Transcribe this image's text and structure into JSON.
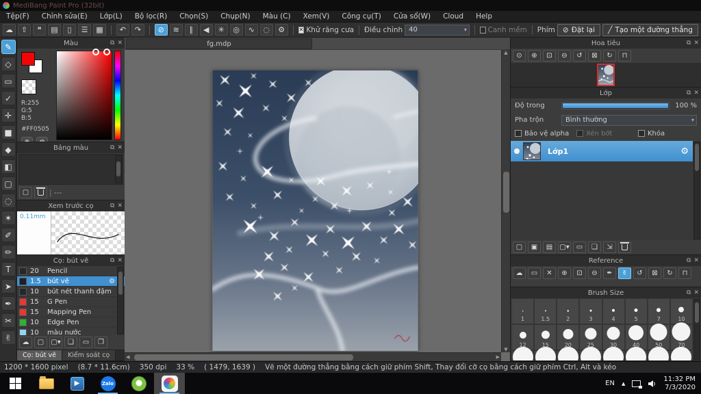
{
  "window": {
    "title": "MediBang Paint Pro (32bit)"
  },
  "menu": {
    "items": [
      {
        "name": "menu-file",
        "label": "Tệp(F)"
      },
      {
        "name": "menu-edit",
        "label": "Chỉnh sửa(E)"
      },
      {
        "name": "menu-layer",
        "label": "Lớp(L)"
      },
      {
        "name": "menu-filter",
        "label": "Bộ lọc(R)"
      },
      {
        "name": "menu-select",
        "label": "Chọn(S)"
      },
      {
        "name": "menu-capture",
        "label": "Chụp(N)"
      },
      {
        "name": "menu-color",
        "label": "Màu (C)"
      },
      {
        "name": "menu-view",
        "label": "Xem(V)"
      },
      {
        "name": "menu-tools",
        "label": "Công cụ(T)"
      },
      {
        "name": "menu-window",
        "label": "Cửa sổ(W)"
      },
      {
        "name": "menu-cloud",
        "label": "Cloud"
      },
      {
        "name": "menu-help",
        "label": "Help"
      }
    ]
  },
  "toolbar": {
    "file_buttons": [
      {
        "name": "cloud-button",
        "glyph": "☁"
      },
      {
        "name": "export-button",
        "glyph": "⇧"
      },
      {
        "name": "comment-button",
        "glyph": "❝"
      },
      {
        "name": "note-button",
        "glyph": "▤"
      },
      {
        "name": "document-button",
        "glyph": "▯"
      },
      {
        "name": "list-button",
        "glyph": "☰"
      },
      {
        "name": "grid-button",
        "glyph": "▦"
      }
    ],
    "history_buttons": [
      {
        "name": "undo-button",
        "glyph": "↶"
      },
      {
        "name": "redo-button",
        "glyph": "↷"
      }
    ],
    "snap_buttons": [
      {
        "name": "snap-off-button",
        "glyph": "⊘",
        "sel": true
      },
      {
        "name": "snap-parallel-button",
        "glyph": "≋"
      },
      {
        "name": "snap-crosshatch-button",
        "glyph": "∥"
      },
      {
        "name": "snap-vanishing-button",
        "glyph": "◀"
      },
      {
        "name": "snap-radial-button",
        "glyph": "✳"
      },
      {
        "name": "snap-concentric-button",
        "glyph": "◎"
      },
      {
        "name": "snap-curve-button",
        "glyph": "∿"
      },
      {
        "name": "snap-ellipse-button",
        "glyph": "◌"
      },
      {
        "name": "snap-settings-button",
        "glyph": "⚙"
      }
    ],
    "antialias_label": "Khử răng cưa",
    "correction_label": "Điều chỉnh",
    "correction_value": "40",
    "soft_edge_label": "Canh mềm",
    "key_label": "Phím",
    "reset_label": "Đặt lại",
    "line_label": "Tạo một đường thẳng"
  },
  "tools": [
    {
      "name": "brush-tool",
      "glyph": "✎",
      "sel": true
    },
    {
      "name": "eraser-tool",
      "glyph": "◇"
    },
    {
      "name": "figure-brush-tool",
      "glyph": "▭"
    },
    {
      "name": "control-point-tool",
      "glyph": "✓"
    },
    {
      "name": "move-tool",
      "glyph": "✛"
    },
    {
      "name": "fill-rect-tool",
      "glyph": "■"
    },
    {
      "name": "bucket-tool",
      "glyph": "◆"
    },
    {
      "name": "gradient-tool",
      "glyph": "◧"
    },
    {
      "name": "select-tool",
      "glyph": "▢"
    },
    {
      "name": "lasso-tool",
      "glyph": "◌"
    },
    {
      "name": "magic-wand-tool",
      "glyph": "✶"
    },
    {
      "name": "select-pen-tool",
      "glyph": "✐"
    },
    {
      "name": "select-eraser-tool",
      "glyph": "✏"
    },
    {
      "name": "text-tool",
      "glyph": "T"
    },
    {
      "name": "operation-tool",
      "glyph": "➤"
    },
    {
      "name": "eyedropper-tool",
      "glyph": "✒"
    },
    {
      "name": "divide-tool",
      "glyph": "✂"
    },
    {
      "name": "hand-tool",
      "glyph": "✌"
    }
  ],
  "color_panel": {
    "title": "Màu",
    "r": "R:255",
    "g": "G:5",
    "b": "B:5",
    "hex": "#FF0505",
    "foreground": "#F20505",
    "buttons": [
      {
        "name": "palette-mode-button",
        "glyph": "◉"
      },
      {
        "name": "color-set-button",
        "glyph": "◍"
      }
    ]
  },
  "palette_panel": {
    "title": "Bảng màu",
    "empty_label": "---",
    "buttons": [
      {
        "name": "palette-add-button",
        "glyph": "▢"
      },
      {
        "name": "palette-delete-button",
        "glyph": "",
        "cls": "has-trash"
      }
    ]
  },
  "preview_panel": {
    "title": "Xem trước cọ",
    "size_label": "0.11mm"
  },
  "brush_panel": {
    "title": "Cọ: bút vẽ",
    "brushes": [
      {
        "size": "20",
        "name": "Pencil",
        "chip": "#26262b",
        "sel": false
      },
      {
        "size": "1.5",
        "name": "bút vẽ",
        "chip": "#1e2126",
        "sel": true
      },
      {
        "size": "10",
        "name": "bút nét thanh đậm",
        "chip": "#23262b",
        "sel": false
      },
      {
        "size": "15",
        "name": "G Pen",
        "chip": "#e8392f",
        "sel": false
      },
      {
        "size": "15",
        "name": "Mapping Pen",
        "chip": "#e8392f",
        "sel": false
      },
      {
        "size": "10",
        "name": "Edge Pen",
        "chip": "#2eb135",
        "sel": false
      },
      {
        "size": "10",
        "name": "màu nước",
        "chip": "#8fd8f2",
        "sel": false
      }
    ],
    "buttons": [
      {
        "name": "brush-cloud-button",
        "glyph": "☁"
      },
      {
        "name": "brush-add-button",
        "glyph": "▢"
      },
      {
        "name": "brush-add-menu-button",
        "glyph": "▢▾"
      },
      {
        "name": "brush-duplicate-button",
        "glyph": "❏"
      },
      {
        "name": "brush-folder-button",
        "glyph": "▭"
      },
      {
        "name": "brush-copy-button",
        "glyph": "❐"
      }
    ],
    "tabs": [
      "Cọ: bút vẽ",
      "Kiểm soát cọ"
    ]
  },
  "canvas": {
    "tab": "fg.mdp"
  },
  "navigator_panel": {
    "title": "Hoa tiêu",
    "buttons": [
      {
        "name": "zoom-actual-button",
        "glyph": "⊙"
      },
      {
        "name": "zoom-in-button",
        "glyph": "⊕"
      },
      {
        "name": "fit-window-button",
        "glyph": "⊡"
      },
      {
        "name": "zoom-out-button",
        "glyph": "⊖"
      },
      {
        "name": "rotate-ccw-button",
        "glyph": "↺"
      },
      {
        "name": "reset-view-button",
        "glyph": "⊠"
      },
      {
        "name": "rotate-cw-button",
        "glyph": "↻"
      },
      {
        "name": "lock-rotation-button",
        "glyph": "⊓"
      }
    ]
  },
  "layer_panel": {
    "title": "Lớp",
    "opacity_label": "Độ trong",
    "opacity_value": "100 %",
    "blend_label": "Pha trộn",
    "blend_value": "Bình thường",
    "alpha_label": "Bảo vệ alpha",
    "clip_label": "Xén bớt",
    "lock_label": "Khóa",
    "layers": [
      {
        "name": "Lớp1"
      }
    ],
    "buttons": [
      {
        "name": "layer-add-button",
        "glyph": "▢"
      },
      {
        "name": "layer-add-8bit-button",
        "glyph": "▣"
      },
      {
        "name": "layer-add-1bit-button",
        "glyph": "▤"
      },
      {
        "name": "layer-add-menu-button",
        "glyph": "▢▾"
      },
      {
        "name": "layer-folder-button",
        "glyph": "▭"
      },
      {
        "name": "layer-duplicate-button",
        "glyph": "❏"
      },
      {
        "name": "layer-merge-button",
        "glyph": "⇲"
      },
      {
        "name": "layer-delete-button",
        "glyph": "",
        "cls": "has-trash"
      }
    ]
  },
  "reference_panel": {
    "title": "Reference",
    "buttons": [
      {
        "name": "ref-cloud-button",
        "glyph": "☁"
      },
      {
        "name": "ref-open-button",
        "glyph": "▭"
      },
      {
        "name": "ref-close-button",
        "glyph": "✕"
      },
      {
        "name": "ref-zoom-in-button",
        "glyph": "⊕"
      },
      {
        "name": "ref-fit-button",
        "glyph": "⊡"
      },
      {
        "name": "ref-zoom-out-button",
        "glyph": "⊖"
      },
      {
        "name": "ref-eyedropper-button",
        "glyph": "✒"
      },
      {
        "name": "ref-hand-button",
        "glyph": "✌",
        "sel": true
      },
      {
        "name": "ref-rotate-ccw-button",
        "glyph": "↺"
      },
      {
        "name": "ref-reset-button",
        "glyph": "⊠"
      },
      {
        "name": "ref-rotate-cw-button",
        "glyph": "↻"
      },
      {
        "name": "ref-lock-button",
        "glyph": "⊓"
      }
    ]
  },
  "brush_size_panel": {
    "title": "Brush Size",
    "rows": [
      {
        "labels": [
          "1",
          "1.5",
          "2",
          "3",
          "4",
          "5",
          "7",
          "10"
        ],
        "dots": [
          1.5,
          2,
          2.5,
          3,
          4,
          5,
          6,
          8
        ]
      },
      {
        "labels": [
          "12",
          "15",
          "20",
          "25",
          "30",
          "40",
          "50",
          "70"
        ],
        "dots": [
          10,
          12,
          15,
          17,
          19,
          22,
          25,
          27
        ]
      },
      {
        "labels": [
          "",
          "",
          "",
          "",
          "",
          "",
          "",
          ""
        ],
        "dots": [
          30,
          30,
          30,
          30,
          30,
          30,
          30,
          30
        ]
      }
    ]
  },
  "status_bar": {
    "dimensions": "1200 * 1600 pixel",
    "physical": "(8.7 * 11.6cm)",
    "dpi": "350 dpi",
    "zoom": "33 %",
    "coords": "( 1479, 1639 )",
    "hint": "Vẽ một đường thẳng bằng cách giữ phím Shift, Thay đổi cỡ cọ bằng cách giữ phím Ctrl, Alt và kéo"
  },
  "taskbar": {
    "zalo_label": "Zalo",
    "language": "EN",
    "time": "11:32 PM",
    "date": "7/3/2020"
  }
}
